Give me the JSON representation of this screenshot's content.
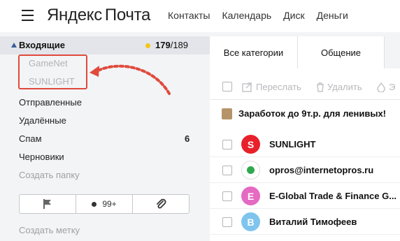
{
  "header": {
    "logo_first": "Яндекс",
    "logo_second": "Почта",
    "nav": [
      "Контакты",
      "Календарь",
      "Диск",
      "Деньги"
    ]
  },
  "sidebar": {
    "inbox": {
      "label": "Входящие",
      "unread": "179",
      "separator": "/",
      "total": "189"
    },
    "subfolders": [
      "GameNet",
      "SUNLIGHT"
    ],
    "folders": [
      {
        "label": "Отправленные",
        "count": ""
      },
      {
        "label": "Удалённые",
        "count": ""
      },
      {
        "label": "Спам",
        "count": "6"
      },
      {
        "label": "Черновики",
        "count": ""
      }
    ],
    "create_folder": "Создать папку",
    "filters": {
      "unread_label": "99+"
    },
    "create_label": "Создать метку"
  },
  "main": {
    "tabs": [
      "Все категории",
      "Общение"
    ],
    "toolbar": {
      "forward": "Переслать",
      "delete": "Удалить",
      "spam": "Э"
    },
    "ad_subject": "Заработок до 9т.р. для ленивых!",
    "messages": [
      {
        "sender": "SUNLIGHT",
        "avatar_letter": "S",
        "avatar_color": "#e8202a"
      },
      {
        "sender": "opros@internetopros.ru",
        "avatar_letter": "",
        "avatar_color": "#2fa84f"
      },
      {
        "sender": "E-Global Trade & Finance G...",
        "avatar_letter": "E",
        "avatar_color": "#e46ac2"
      },
      {
        "sender": "Виталий Тимофеев",
        "avatar_letter": "B",
        "avatar_color": "#7fc4ee"
      }
    ]
  },
  "colors": {
    "accent_red": "#e04a3c",
    "inbox_dot": "#f5c518"
  }
}
